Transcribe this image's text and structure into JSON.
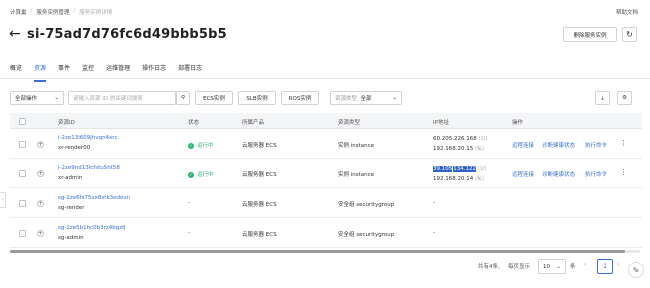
{
  "breadcrumb": [
    "计算巢",
    "服务实例管理",
    "服务实例详情"
  ],
  "help_label": "帮助文档",
  "title": "si-75ad7d76fc6d49bbb5b5",
  "actions": {
    "delete": "删除服务实例",
    "refresh_icon": "refresh-icon"
  },
  "tabs": [
    "概览",
    "资源",
    "事件",
    "监控",
    "运维管理",
    "操作日志",
    "部署日志"
  ],
  "active_tab": "资源",
  "toolbar": {
    "ops_select": "全部操作",
    "search_placeholder": "请输入资源 ID 的关键词搜索",
    "filters": [
      "ECS实例",
      "SLB实例",
      "ROS实例"
    ],
    "type_label": "资源类型",
    "type_value": "全部"
  },
  "columns": [
    "资源ID",
    "状态",
    "所属产品",
    "资源类型",
    "IP地址",
    "操作"
  ],
  "rows": [
    {
      "id": "i-2ze13i609jhvqn4xrc",
      "name": "xr-render00",
      "status": "运行中",
      "product": "云服务器 ECS",
      "type": "实例 instance",
      "ip1": "60.205.226.168",
      "ip1_suffix": "(公)",
      "ip2": "192.168.20.15",
      "ip2_suffix": "(私)",
      "ops": [
        "远程连接",
        "诊断健康状态",
        "执行命令"
      ]
    },
    {
      "id": "i-2ze9nd13lcfstu5ht58",
      "name": "xr-admin",
      "status": "运行中",
      "product": "云服务器 ECS",
      "type": "实例 instance",
      "ip1_hl_a": "39.105",
      "ip1_hl_b": "134.122",
      "ip1_suffix": "(公)",
      "ip2": "192.168.20.14",
      "ip2_suffix": "(私)",
      "ops": [
        "远程连接",
        "诊断健康状态",
        "执行命令"
      ]
    },
    {
      "id": "sg-2ze6fs75vx8stk3edovn",
      "name": "sg-render",
      "status": "-",
      "product": "云服务器 ECS",
      "type": "安全组 securitygroup",
      "ip": "-"
    },
    {
      "id": "sg-2ze5b1hc0b3rz4bgzfj",
      "name": "sg-admin",
      "status": "-",
      "product": "云服务器 ECS",
      "type": "安全组 securitygroup",
      "ip": "-"
    }
  ],
  "footer": {
    "total": "共有4条,",
    "per_page_label": "每页显示",
    "per_page": "10",
    "unit": "条",
    "prev": "‹",
    "page": "1",
    "next": "›"
  }
}
